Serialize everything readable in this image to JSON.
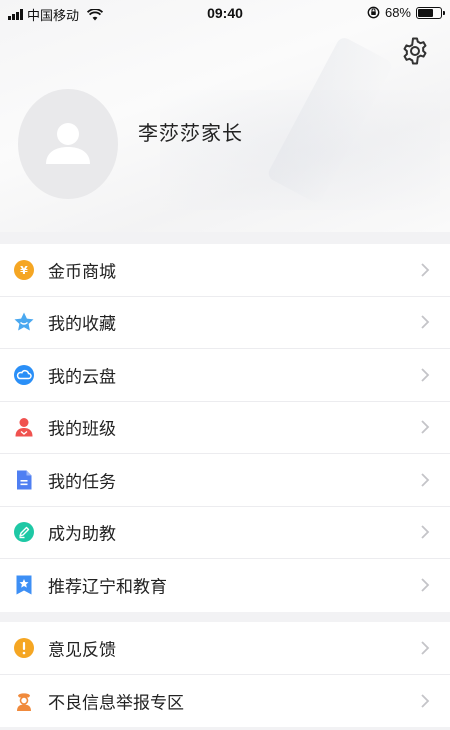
{
  "status_bar": {
    "carrier": "中国移动",
    "time": "09:40",
    "battery": "68%",
    "battery_level": 0.68
  },
  "profile": {
    "name": "李莎莎家长"
  },
  "menu_group1": [
    {
      "label": "金币商城",
      "icon": "coin-icon",
      "color": "#f5a623"
    },
    {
      "label": "我的收藏",
      "icon": "star-icon",
      "color": "#4aa8f0"
    },
    {
      "label": "我的云盘",
      "icon": "cloud-icon",
      "color": "#2a8ff7"
    },
    {
      "label": "我的班级",
      "icon": "class-icon",
      "color": "#f0524f"
    },
    {
      "label": "我的任务",
      "icon": "task-icon",
      "color": "#4f7ff2"
    },
    {
      "label": "成为助教",
      "icon": "assistant-icon",
      "color": "#1ec8a5"
    },
    {
      "label": "推荐辽宁和教育",
      "icon": "recommend-icon",
      "color": "#3d8ff5"
    }
  ],
  "menu_group2": [
    {
      "label": "意见反馈",
      "icon": "feedback-icon",
      "color": "#f5a623"
    },
    {
      "label": "不良信息举报专区",
      "icon": "report-icon",
      "color": "#f08a3c"
    }
  ]
}
